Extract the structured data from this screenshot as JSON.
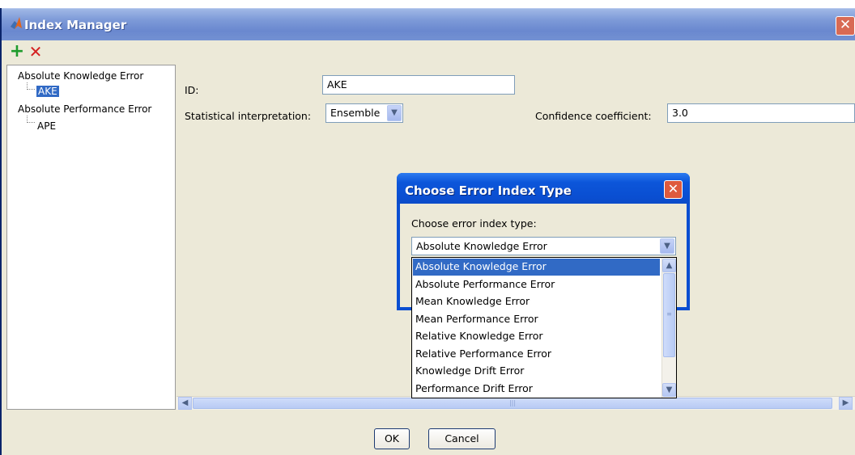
{
  "window": {
    "title": "Index Manager",
    "close_glyph": "✕"
  },
  "toolbar": {
    "add_glyph": "+",
    "delete_glyph": "✕"
  },
  "tree": {
    "items": [
      {
        "label": "Absolute Knowledge Error",
        "children": [
          "AKE"
        ]
      },
      {
        "label": "Absolute Performance Error",
        "children": [
          "APE"
        ]
      }
    ],
    "selected": "AKE"
  },
  "form": {
    "id_label": "ID:",
    "id_value": "AKE",
    "stat_label": "Statistical interpretation:",
    "stat_value": "Ensemble",
    "conf_label": "Confidence coefficient:",
    "conf_value": "3.0"
  },
  "buttons": {
    "ok": "OK",
    "cancel": "Cancel"
  },
  "dialog": {
    "title": "Choose Error Index Type",
    "close_glyph": "✕",
    "label": "Choose error index type:",
    "selected_value": "Absolute Knowledge Error",
    "options": [
      "Absolute Knowledge Error",
      "Absolute Performance Error",
      "Mean Knowledge Error",
      "Mean Performance Error",
      "Relative Knowledge Error",
      "Relative Performance Error",
      "Knowledge Drift Error",
      "Performance Drift Error"
    ],
    "highlighted_index": 0
  },
  "icons": {
    "window_logo": "matlab-logo-icon",
    "combo_arrow": "chevron-down-icon",
    "scroll_left": "arrow-left-icon",
    "scroll_right": "arrow-right-icon",
    "scroll_up": "arrow-up-icon",
    "scroll_down": "arrow-down-icon"
  },
  "colors": {
    "titlebar": "#7d9ad8",
    "dialog_titlebar": "#0a4ed1",
    "selection": "#316ac5",
    "add": "#1e9b2c",
    "delete": "#d42020"
  }
}
